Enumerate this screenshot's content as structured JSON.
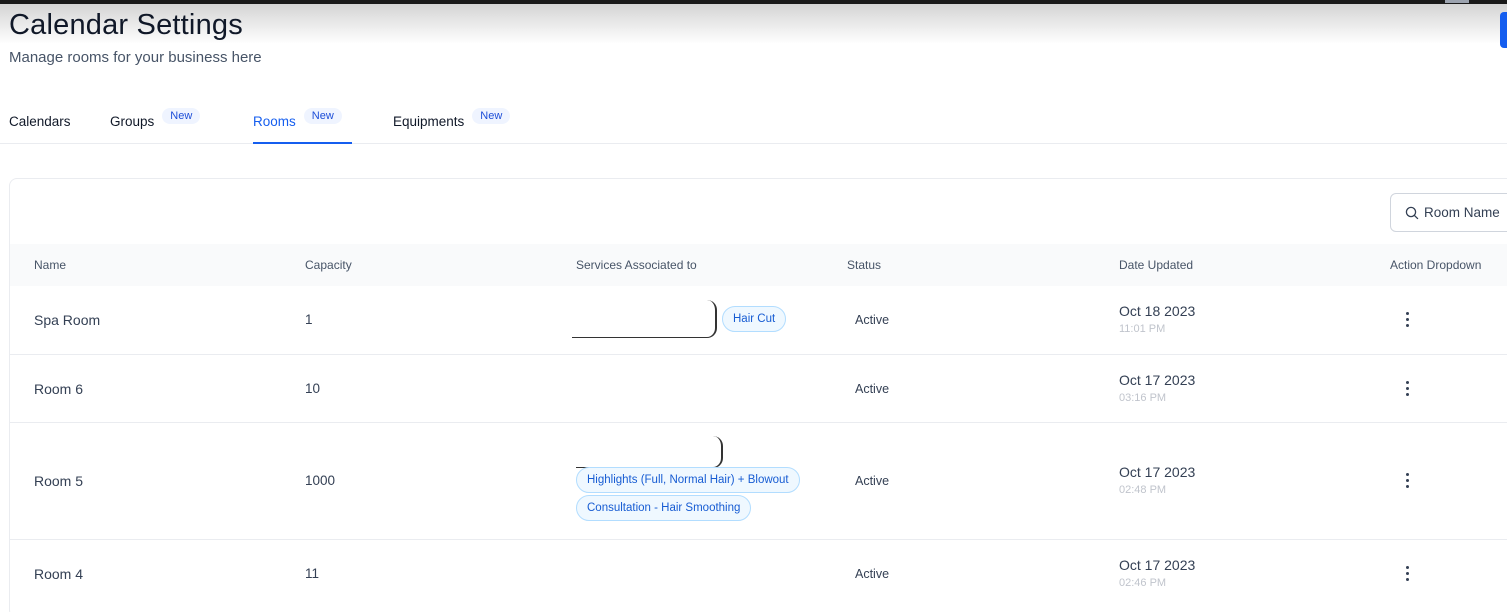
{
  "header": {
    "title": "Calendar Settings",
    "subtitle": "Manage rooms for your business here"
  },
  "tabs": [
    {
      "label": "Calendars",
      "badge": ""
    },
    {
      "label": "Groups",
      "badge": "New"
    },
    {
      "label": "Rooms",
      "badge": "New",
      "active": true
    },
    {
      "label": "Equipments",
      "badge": "New"
    }
  ],
  "search": {
    "placeholder": "Room Name"
  },
  "table": {
    "columns": [
      "Name",
      "Capacity",
      "Services Associated to",
      "Status",
      "Date Updated",
      "Action Dropdown"
    ],
    "rows": [
      {
        "name": "Spa Room",
        "capacity": "1",
        "services": [
          "Hair Cut"
        ],
        "status": "Active",
        "date": "Oct 18 2023",
        "time": "11:01 PM"
      },
      {
        "name": "Room 6",
        "capacity": "10",
        "services": [],
        "status": "Active",
        "date": "Oct 17 2023",
        "time": "03:16 PM"
      },
      {
        "name": "Room 5",
        "capacity": "1000",
        "services": [
          "Highlights (Full, Normal Hair) + Blowout",
          "Consultation - Hair Smoothing"
        ],
        "status": "Active",
        "date": "Oct 17 2023",
        "time": "02:48 PM"
      },
      {
        "name": "Room 4",
        "capacity": "11",
        "services": [],
        "status": "Active",
        "date": "Oct 17 2023",
        "time": "02:46 PM"
      }
    ]
  },
  "colors": {
    "accent": "#155eef",
    "chip_text": "#175cd3",
    "chip_bg": "#eff8ff"
  },
  "icons": {
    "search": "search-icon",
    "action": "kebab-menu-icon"
  }
}
